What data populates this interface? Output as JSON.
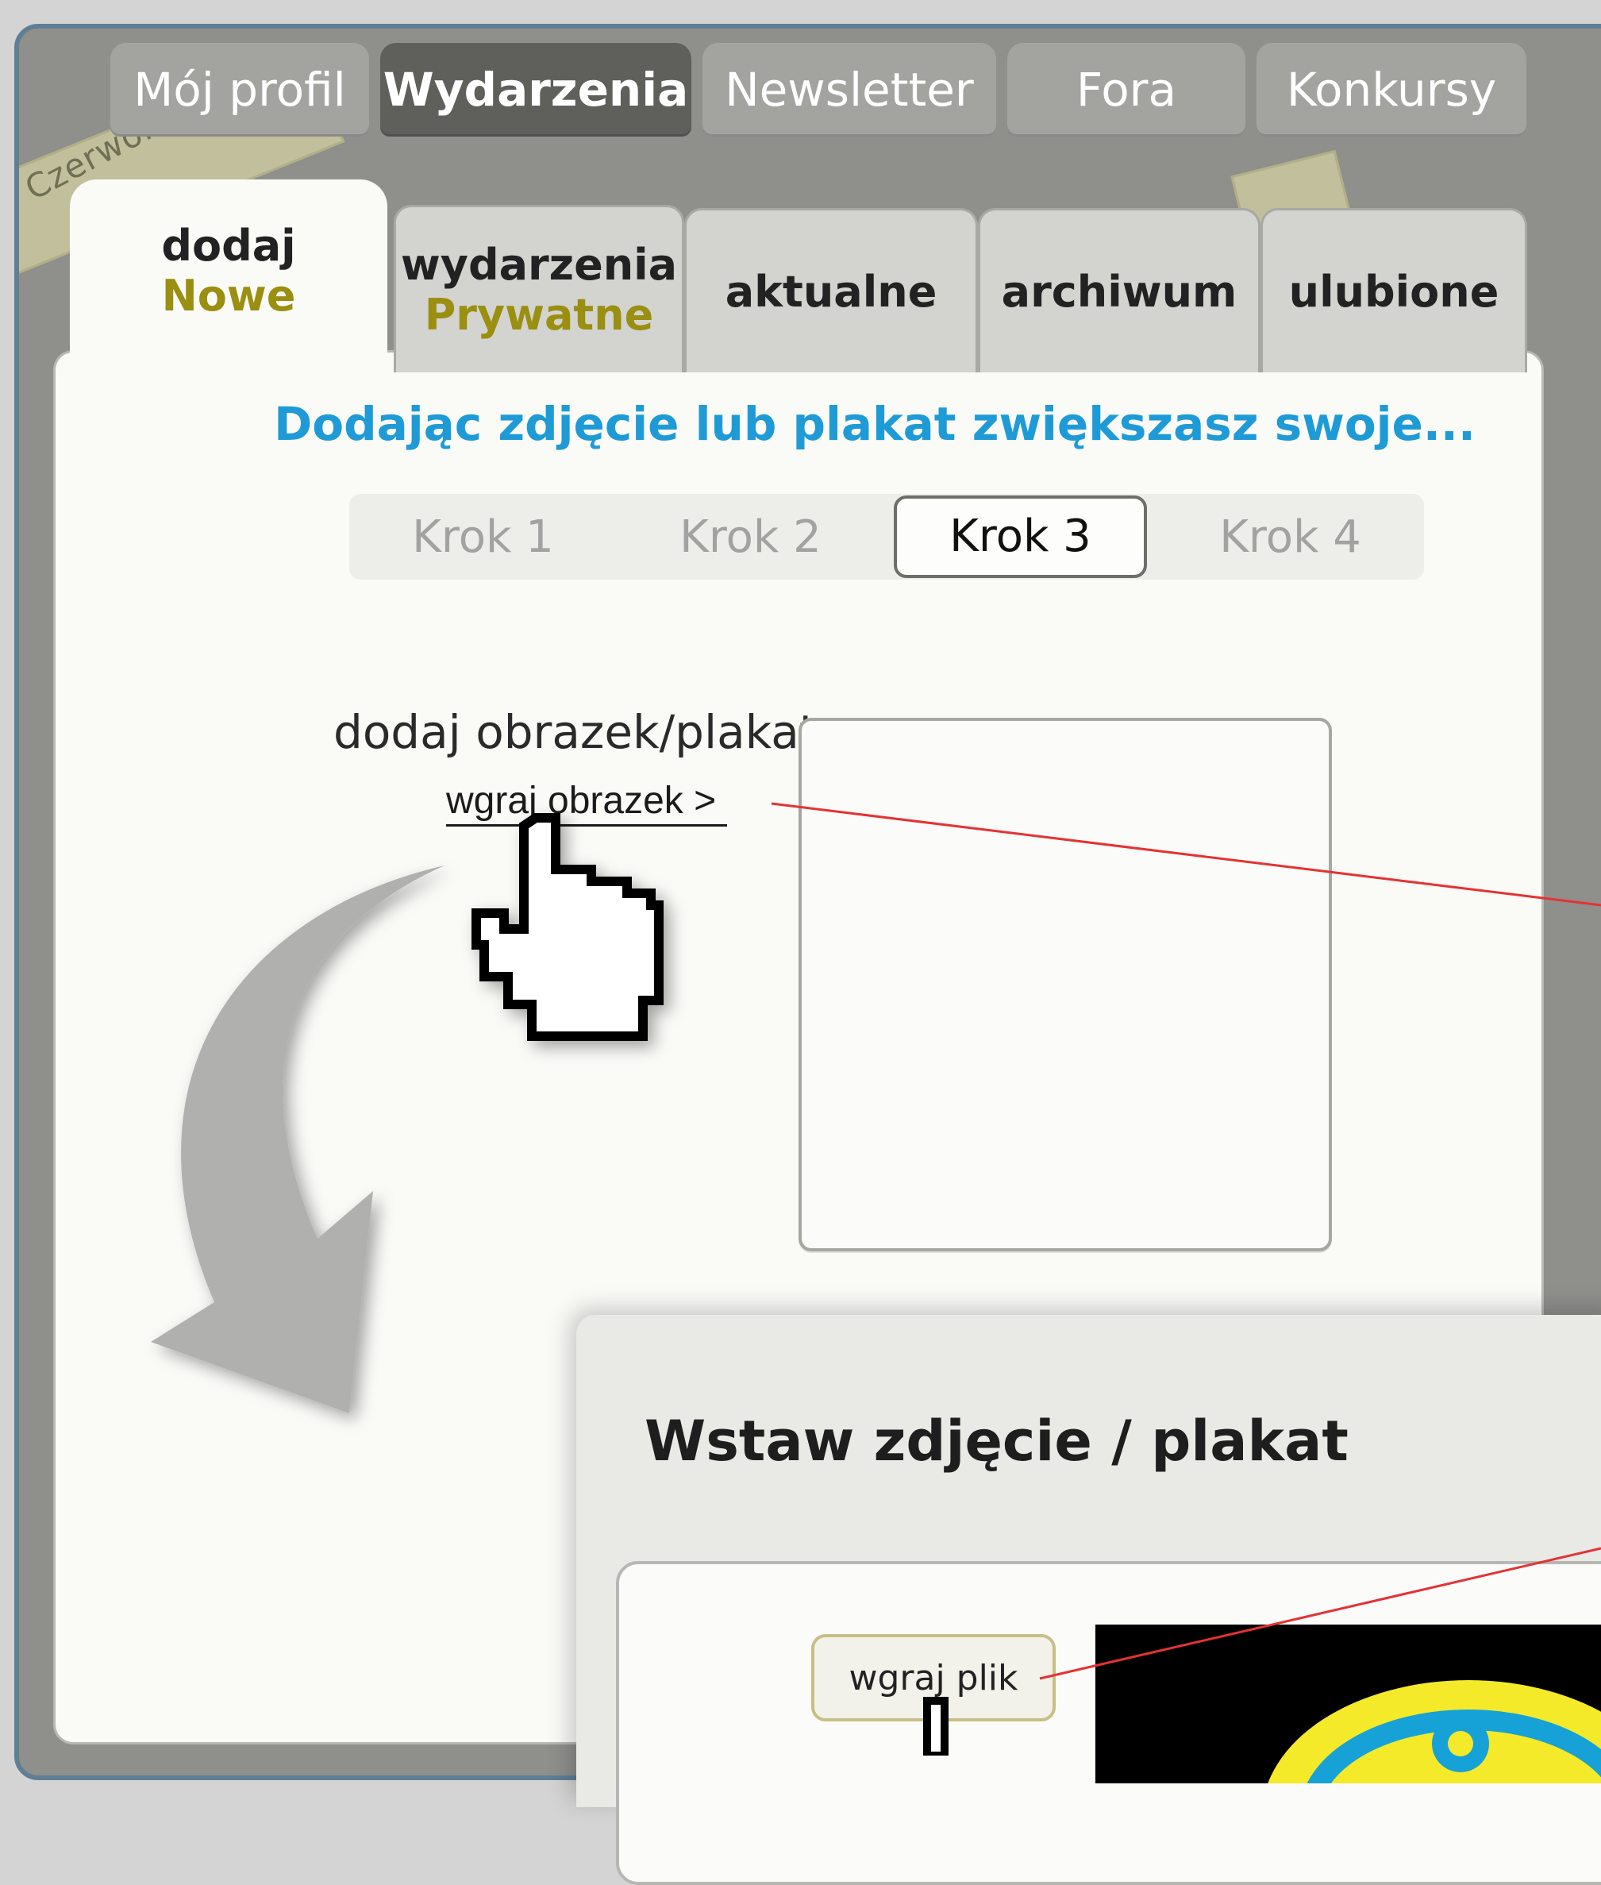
{
  "top_nav": {
    "tabs": [
      {
        "label": "Mój profil"
      },
      {
        "label": "Wydarzenia"
      },
      {
        "label": "Newsletter"
      },
      {
        "label": "Fora"
      },
      {
        "label": "Konkursy"
      }
    ],
    "active_index": 1
  },
  "map": {
    "road_label": "Czerwona Droga"
  },
  "sub_tabs": [
    {
      "line1": "dodaj",
      "line2": "Nowe"
    },
    {
      "line1": "wydarzenia",
      "line2": "Prywatne"
    },
    {
      "line1": "aktualne",
      "line2": ""
    },
    {
      "line1": "archiwum",
      "line2": ""
    },
    {
      "line1": "ulubione",
      "line2": ""
    }
  ],
  "main": {
    "headline": "Dodając zdjęcie lub plakat zwiększasz swoje...",
    "steps": [
      "Krok 1",
      "Krok 2",
      "Krok 3",
      "Krok 4"
    ],
    "active_step": 3,
    "add_image_label": "dodaj obrazek/plakat",
    "upload_link": "wgraj obrazek >"
  },
  "modal": {
    "title": "Wstaw zdjęcie / plakat",
    "upload_button": "wgraj plik"
  },
  "colors": {
    "accent_blue": "#1e9bd6",
    "accent_olive": "#9a8f10",
    "arrow_gray": "#b0b0ae",
    "link_line_red": "#e53232"
  }
}
